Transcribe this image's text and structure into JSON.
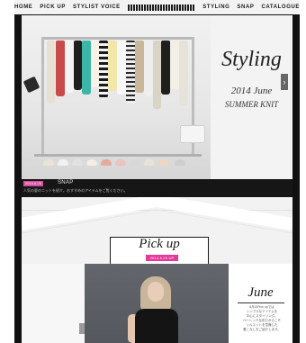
{
  "nav": {
    "items": [
      "HOME",
      "PICK UP",
      "STYLIST VOICE",
      "STYLING",
      "SNAP",
      "CATALOGUE"
    ]
  },
  "hero": {
    "title": "Styling",
    "subtitle_line1": "2014 June",
    "subtitle_line2": "SUMMER KNIT",
    "next_arrow": "›"
  },
  "caption": {
    "badge": "2014.6.25",
    "category": "SNAP",
    "text": "人気の夏のニットを紹介。おすすめのアイテムをご覧ください。"
  },
  "pickup": {
    "title": "Pick up",
    "date": "2014.6.25 UP",
    "month": "June",
    "description": "6月のPick upでは\nシンプルなアイテムを\n中心にスタイリング。\nベーシックな形だからこそ\nシルエットを意識した\n着こなしをご紹介します。"
  },
  "colors": {
    "accent_pink": "#e4389a",
    "site_dark": "#111111"
  }
}
